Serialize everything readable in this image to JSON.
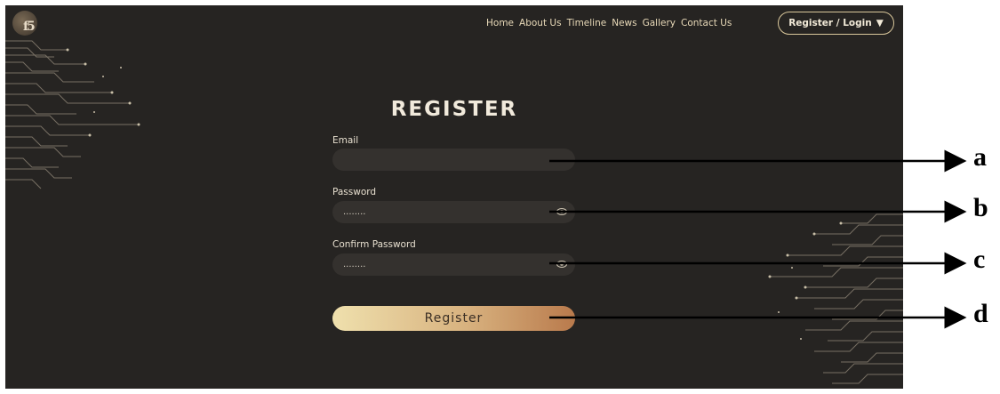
{
  "header": {
    "logo_text": "f5",
    "nav": [
      "Home",
      "About Us",
      "Timeline",
      "News",
      "Gallery",
      "Contact Us"
    ],
    "account_button": "Register / Login",
    "account_caret": "▼"
  },
  "form": {
    "title": "REGISTER",
    "email": {
      "label": "Email",
      "value": ""
    },
    "password": {
      "label": "Password",
      "value": "........"
    },
    "confirm_password": {
      "label": "Confirm Password",
      "value": "........"
    },
    "submit": "Register"
  },
  "annotations": [
    "a",
    "b",
    "c",
    "d"
  ],
  "colors": {
    "background": "#262422",
    "accent_gold": "#d9c79b",
    "field": "#34312e"
  }
}
